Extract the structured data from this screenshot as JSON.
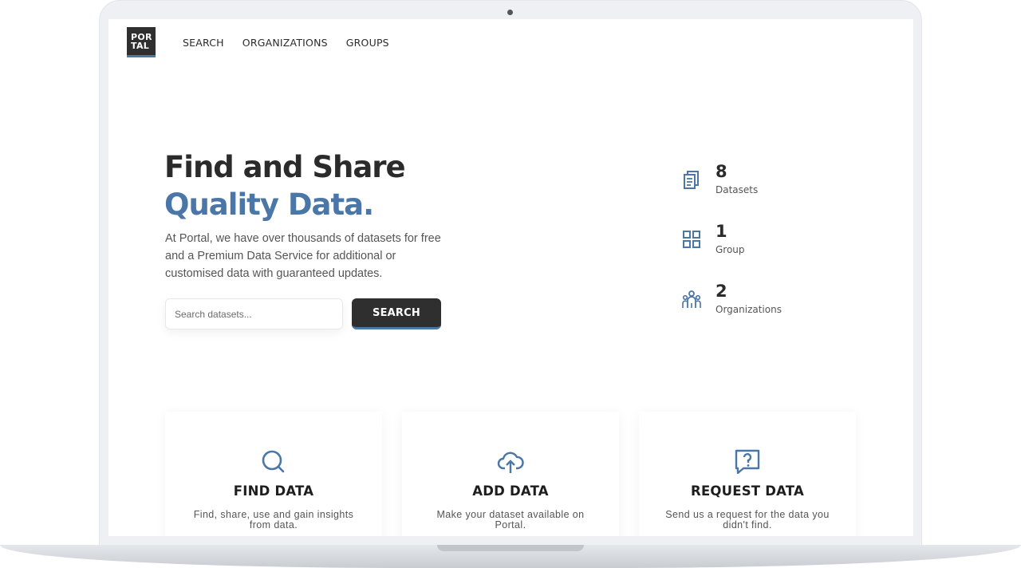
{
  "header": {
    "logo_line1": "POR",
    "logo_line2": "TAL",
    "nav": [
      "SEARCH",
      "ORGANIZATIONS",
      "GROUPS"
    ]
  },
  "hero": {
    "title_line1": "Find and Share",
    "title_line2": "Quality Data.",
    "description": "At Portal, we have over thousands of datasets for free and a Premium Data Service for additional or customised data with guaranteed updates.",
    "search_placeholder": "Search datasets...",
    "search_button": "SEARCH"
  },
  "stats": [
    {
      "value": "8",
      "label": "Datasets",
      "icon": "document-icon"
    },
    {
      "value": "1",
      "label": "Group",
      "icon": "grid-icon"
    },
    {
      "value": "2",
      "label": "Organizations",
      "icon": "people-icon"
    }
  ],
  "cards": [
    {
      "title": "FIND DATA",
      "text": "Find, share, use and gain insights from data.",
      "icon": "search-icon"
    },
    {
      "title": "ADD DATA",
      "text": "Make your dataset available on Portal.",
      "icon": "cloud-upload-icon"
    },
    {
      "title": "REQUEST DATA",
      "text": "Send us a request for the data you didn't find.",
      "icon": "question-message-icon"
    }
  ],
  "colors": {
    "accent": "#4a76a8",
    "dark": "#2f2f2f"
  }
}
